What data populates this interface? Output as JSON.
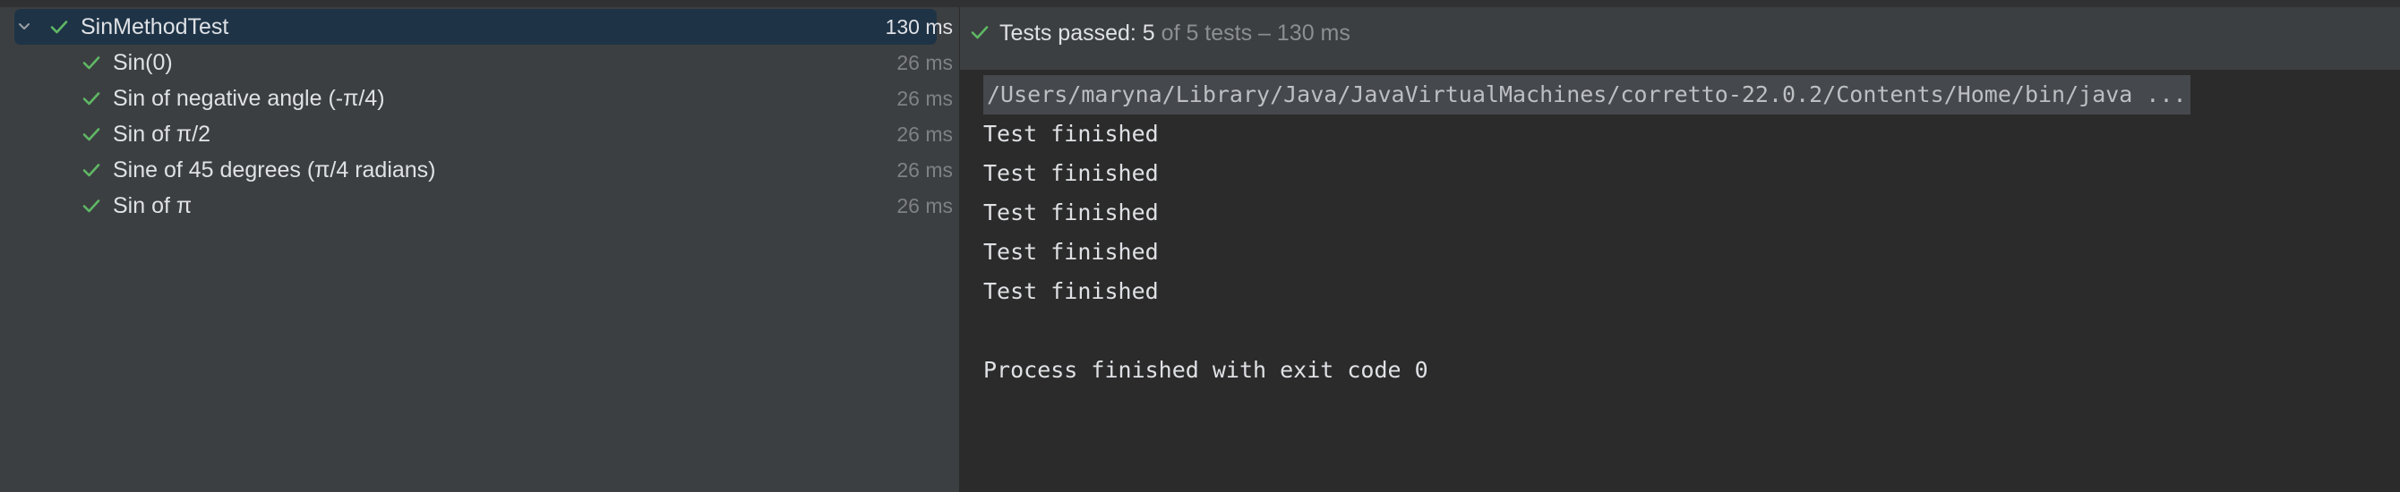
{
  "tree": {
    "root": {
      "label": "SinMethodTest",
      "duration": "130 ms"
    },
    "items": [
      {
        "label": "Sin(0)",
        "duration": "26 ms"
      },
      {
        "label": "Sin of negative angle (-π/4)",
        "duration": "26 ms"
      },
      {
        "label": "Sin of π/2",
        "duration": "26 ms"
      },
      {
        "label": "Sine of 45 degrees (π/4 radians)",
        "duration": "26 ms"
      },
      {
        "label": "Sin of π",
        "duration": "26 ms"
      }
    ]
  },
  "status": {
    "passed_label": "Tests passed: 5",
    "rest_label": " of 5 tests – 130 ms"
  },
  "console": {
    "command": "/Users/maryna/Library/Java/JavaVirtualMachines/corretto-22.0.2/Contents/Home/bin/java ...",
    "lines": [
      "Test finished",
      "Test finished",
      "Test finished",
      "Test finished",
      "Test finished"
    ],
    "exit_line": "Process finished with exit code 0"
  },
  "icons": {
    "check": "check-icon",
    "chevron": "chevron-down-icon"
  },
  "colors": {
    "pass_green": "#5fb865",
    "selection": "#1e3346",
    "panel_bg": "#3c3f41",
    "console_bg": "#2b2b2b"
  }
}
